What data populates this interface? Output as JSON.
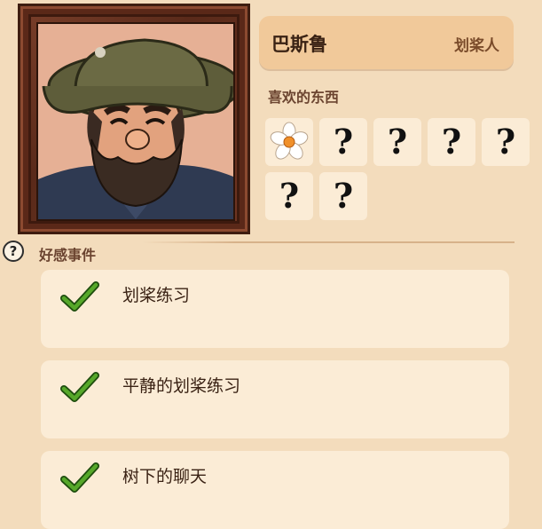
{
  "character": {
    "name": "巴斯鲁",
    "role": "划桨人"
  },
  "likes": {
    "title": "喜欢的东西",
    "items": [
      {
        "icon": "white-flower-icon",
        "known": true
      },
      {
        "icon": "question-mark-icon",
        "known": false,
        "glyph": "?"
      },
      {
        "icon": "question-mark-icon",
        "known": false,
        "glyph": "?"
      },
      {
        "icon": "question-mark-icon",
        "known": false,
        "glyph": "?"
      },
      {
        "icon": "question-mark-icon",
        "known": false,
        "glyph": "?"
      },
      {
        "icon": "question-mark-icon",
        "known": false,
        "glyph": "?"
      },
      {
        "icon": "question-mark-icon",
        "known": false,
        "glyph": "?"
      }
    ]
  },
  "events": {
    "help_glyph": "?",
    "title": "好感事件",
    "items": [
      {
        "label": "划桨练习",
        "completed": true
      },
      {
        "label": "平静的划桨练习",
        "completed": true
      },
      {
        "label": "树下的聊天",
        "completed": true
      }
    ]
  },
  "colors": {
    "background": "#f3dcbc",
    "card": "#fbecd6",
    "banner": "#f1c99a",
    "frame": "#5a2a1a",
    "check": "#3f8a1f"
  }
}
